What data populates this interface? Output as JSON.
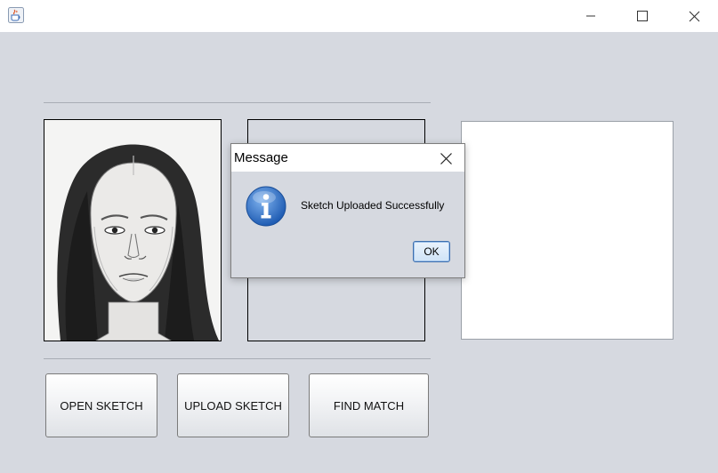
{
  "window": {
    "icon": "java-cup-icon",
    "controls": {
      "minimize": "minimize-icon",
      "maximize": "maximize-icon",
      "close": "close-icon"
    }
  },
  "panels": {
    "sketch_image": "pencil-sketch-face",
    "middle": "",
    "result": ""
  },
  "buttons": {
    "open": "OPEN SKETCH",
    "upload": "UPLOAD SKETCH",
    "find": "FIND MATCH"
  },
  "dialog": {
    "title": "Message",
    "icon": "info-icon",
    "message": "Sketch Uploaded Successfully",
    "ok_label": "OK",
    "close_icon": "close-icon"
  },
  "colors": {
    "background": "#d6d9e0",
    "titlebar": "#ffffff",
    "info_icon_blue": "#2f6fc4",
    "ok_border": "#3d6eae"
  }
}
